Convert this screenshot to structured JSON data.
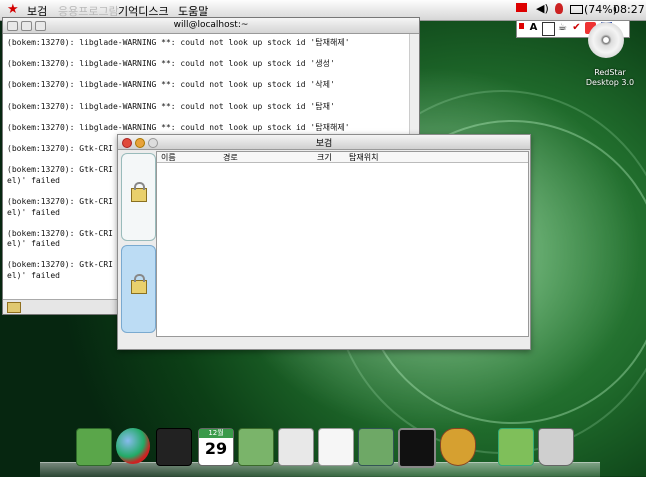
{
  "topbar": {
    "menus": [
      "보검",
      "응용프로그람",
      "기억디스크",
      "도움말"
    ],
    "battery": "(74%)",
    "time": "08:27"
  },
  "desktop": {
    "icon_label_line1": "RedStar",
    "icon_label_line2": "Desktop 3.0"
  },
  "terminal": {
    "title": "will@localhost:~",
    "lines": [
      "(bokem:13270): libglade-WARNING **: could not look up stock id '탑재해제'",
      "",
      "(bokem:13270): libglade-WARNING **: could not look up stock id '생성'",
      "",
      "(bokem:13270): libglade-WARNING **: could not look up stock id '삭제'",
      "",
      "(bokem:13270): libglade-WARNING **: could not look up stock id '탑재'",
      "",
      "(bokem:13270): libglade-WARNING **: could not look up stock id '탑재해제'",
      "",
      "(bokem:13270): Gtk-CRI",
      "",
      "(bokem:13270): Gtk-CRI",
      "el)' failed",
      "",
      "(bokem:13270): Gtk-CRI",
      "el)' failed",
      "",
      "(bokem:13270): Gtk-CRI",
      "el)' failed",
      "",
      "(bokem:13270): Gtk-CRI",
      "el)' failed"
    ]
  },
  "dialog": {
    "title": "보검",
    "columns": [
      "이름",
      "경로",
      "크기",
      "탑재위치"
    ]
  },
  "dock": {
    "calendar_month": "12월",
    "calendar_day": "29"
  }
}
